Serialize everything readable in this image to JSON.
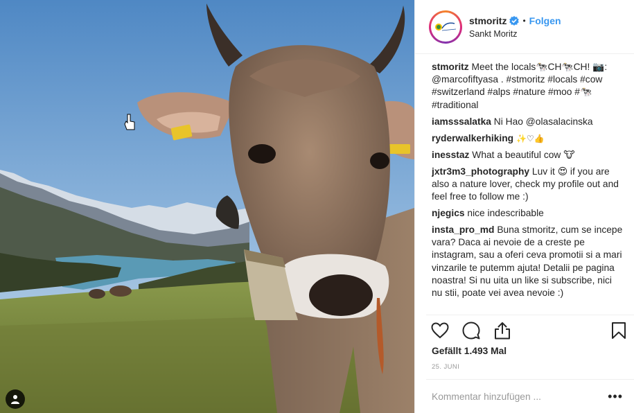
{
  "post": {
    "image_alt": "Cow in alpine meadow above a lake",
    "tag_icon": "person-tag-icon"
  },
  "header": {
    "username": "stmoritz",
    "verified_icon": "verified-badge-icon",
    "separator": "•",
    "follow_label": "Folgen",
    "location": "Sankt Moritz"
  },
  "caption": {
    "username": "stmoritz",
    "text": "Meet the locals🐄CH🐄CH! 📷: @marcofiftyasa . #stmoritz #locals #cow #switzerland #alps #nature #moo #🐄 #traditional"
  },
  "comments": [
    {
      "username": "iamsssalatka",
      "text": "Ni Hao @olasalacinska"
    },
    {
      "username": "ryderwalkerhiking",
      "text": "✨♡👍"
    },
    {
      "username": "inesstaz",
      "text": "What a beautiful cow 🐮"
    },
    {
      "username": "jxtr3m3_photography",
      "text": "Luv it 😍 if you are also a nature lover, check my profile out and feel free to follow me :)"
    },
    {
      "username": "njegics",
      "text": "nice indescribable"
    },
    {
      "username": "insta_pro_md",
      "text": "Buna stmoritz, cum se incepe vara? Daca ai nevoie de a creste pe instagram, sau a oferi ceva promotii si a mari vinzarile te putemm ajuta! Detalii pe pagina noastra! Si nu uita un like si subscribe, nici nu stii, poate vei avea nevoie :)"
    }
  ],
  "actions": {
    "like_icon": "heart-icon",
    "comment_icon": "comment-bubble-icon",
    "share_icon": "share-icon",
    "save_icon": "bookmark-icon"
  },
  "likes_text": "Gefällt 1.493 Mal",
  "date_text": "25. JUNI",
  "comment_box": {
    "placeholder": "Kommentar hinzufügen ...",
    "more_label": "•••"
  },
  "colors": {
    "link": "#3897f0",
    "text": "#262626",
    "muted": "#999999",
    "divider": "#efefef"
  }
}
